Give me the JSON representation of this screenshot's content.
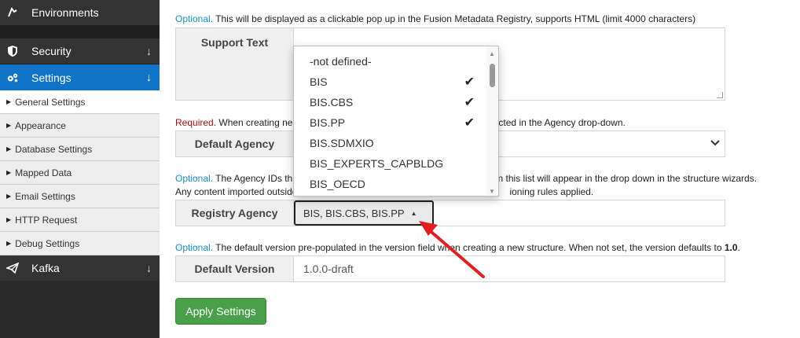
{
  "sidebar": {
    "environments": "Environments",
    "security": "Security",
    "settings": "Settings",
    "kafka": "Kafka",
    "items": [
      {
        "label": "General Settings"
      },
      {
        "label": "Appearance"
      },
      {
        "label": "Database Settings"
      },
      {
        "label": "Mapped Data"
      },
      {
        "label": "Email Settings"
      },
      {
        "label": "HTTP Request"
      },
      {
        "label": "Debug Settings"
      }
    ]
  },
  "support": {
    "note_prefix": "Optional.",
    "note_text": " This will be displayed as a clickable pop up in the Fusion Metadata Registry, supports HTML (limit 4000 characters)",
    "label": "Support Text",
    "value": ""
  },
  "default_agency": {
    "note_prefix": "Required.",
    "note_left": " When creating ne",
    "note_right": "cted in the Agency drop-down.",
    "label": "Default Agency",
    "value": ""
  },
  "registry_agency": {
    "note_prefix": "Optional.",
    "note_line1_left": " The Agency IDs th",
    "note_line1_right": "cies in this list will appear in the drop down in the structure wizards.",
    "note_line2_left": "Any content imported outside",
    "note_line2_right": "ioning rules applied.",
    "label": "Registry Agency",
    "selected": "BIS, BIS.CBS, BIS.PP"
  },
  "dropdown": {
    "options": [
      {
        "label": "-not defined-",
        "checked": false
      },
      {
        "label": "BIS",
        "checked": true
      },
      {
        "label": "BIS.CBS",
        "checked": true
      },
      {
        "label": "BIS.PP",
        "checked": true
      },
      {
        "label": "BIS.SDMXIO",
        "checked": false
      },
      {
        "label": "BIS_EXPERTS_CAPBLDG",
        "checked": false
      },
      {
        "label": "BIS_OECD",
        "checked": false
      }
    ],
    "check_glyph": "✔"
  },
  "default_version": {
    "note_prefix": "Optional.",
    "note_text": " The default version pre-populated in the version field when creating a new structure. When not set, the version defaults to ",
    "note_bold": "1.0",
    "note_end": ".",
    "label": "Default Version",
    "value": "1.0.0-draft"
  },
  "apply_label": "Apply Settings",
  "colors": {
    "accent": "#0f74c8",
    "optional": "#1a8fc7",
    "required": "#9b1111",
    "apply": "#4aa04a",
    "annotation_arrow": "#e02020"
  }
}
